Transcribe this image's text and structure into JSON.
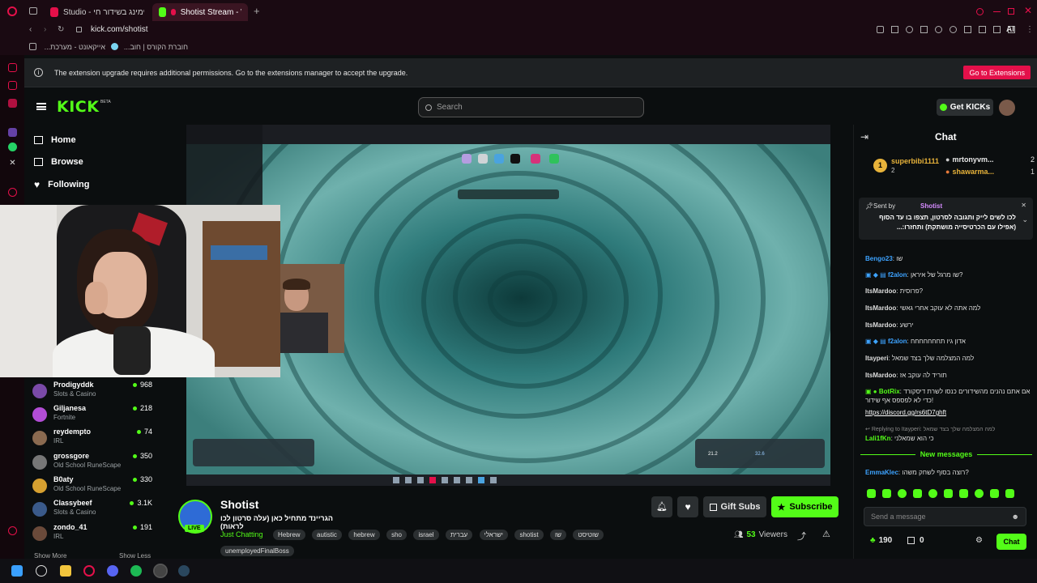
{
  "browser": {
    "tabs": [
      {
        "label": "Studio - סטרימינג בשידור חי",
        "active": false,
        "color": "#e4104a"
      },
      {
        "label": "Shotist Stream - Watch",
        "active": true,
        "color": "#53fc18"
      }
    ],
    "url": "kick.com/shotist",
    "ai_label": "AI",
    "bookmarks": [
      "אייקאונט - מערכת...",
      "חוברת הקורס | חוב..."
    ]
  },
  "extension_bar": {
    "message": "The extension upgrade requires additional permissions. Go to the extensions manager to accept the upgrade.",
    "button": "Go to Extensions"
  },
  "header": {
    "logo": "KICK",
    "beta": "BETA",
    "search_placeholder": "Search",
    "get_kicks": "Get KICKs"
  },
  "nav": {
    "items": [
      {
        "label": "Home",
        "icon": "home-icon"
      },
      {
        "label": "Browse",
        "icon": "browse-icon"
      },
      {
        "label": "Following",
        "icon": "heart-icon"
      }
    ],
    "channels": [
      {
        "name": "Prodigyddk",
        "category": "Slots & Casino",
        "viewers": "968",
        "color": "#7a4aa8"
      },
      {
        "name": "Giljanesa",
        "category": "Fortnite",
        "viewers": "218",
        "color": "#b24dd6"
      },
      {
        "name": "reydempto",
        "category": "IRL",
        "viewers": "74",
        "color": "#8a6a50"
      },
      {
        "name": "grossgore",
        "category": "Old School RuneScape",
        "viewers": "350",
        "color": "#777"
      },
      {
        "name": "B0aty",
        "category": "Old School RuneScape",
        "viewers": "330",
        "color": "#d6a030"
      },
      {
        "name": "Classybeef",
        "category": "Slots & Casino",
        "viewers": "3.1K",
        "color": "#3a5a8a"
      },
      {
        "name": "zondo_41",
        "category": "IRL",
        "viewers": "191",
        "color": "#6a4a3a"
      }
    ],
    "show_more": "Show More",
    "show_less": "Show Less"
  },
  "stream": {
    "streamer": "Shotist",
    "live_badge": "LIVE",
    "title": "הגריינד מתחיל כאן (עלה סרטון לכו לראות)",
    "category": "Just Chatting",
    "tags": [
      "Hebrew",
      "autistic",
      "hebrew",
      "sho",
      "israel",
      "עברית",
      "ישראלי",
      "shotist",
      "שו",
      "שוטיסט",
      "unemployedFinalBoss"
    ],
    "viewers": "53",
    "viewers_label": "Viewers",
    "gift_subs": "Gift Subs",
    "subscribe": "Subscribe"
  },
  "chat": {
    "title": "Chat",
    "top": [
      {
        "name": "superbibi1111",
        "count": "2",
        "rank": "1"
      },
      {
        "name": "mrtonyvm...",
        "count": "2"
      },
      {
        "name": "shawarma...",
        "count": "1"
      }
    ],
    "pinned": {
      "sent_by_label": "Sent by",
      "sender": "Shotist",
      "text": "לכו לשים לייק ותגובה לסרטון, תצפו בו עד הסוף (אפילו עם הכרטיסייה מושתקת) ותחזרו:..."
    },
    "messages": [
      {
        "user": "Bengo23",
        "text": "שו",
        "color": "#3da3ff"
      },
      {
        "user": "f2alon",
        "text": "שו מרגל של איראן?",
        "color": "#3da3ff"
      },
      {
        "user": "ItsMardoo",
        "text": "פרוסית?",
        "color": "#e9e9e9"
      },
      {
        "user": "ItsMardoo",
        "text": "למה אתה לא עוקב אחרי גאשי",
        "color": "#e9e9e9"
      },
      {
        "user": "ItsMardoo",
        "text": "ירשע",
        "color": "#e9e9e9"
      },
      {
        "user": "f2alon",
        "text": "אדון גיו תחחחחחחח",
        "color": "#3da3ff"
      },
      {
        "user": "Itayperi",
        "text": "למה המצלמה שלך בצד שמאל",
        "color": "#e9e9e9"
      },
      {
        "user": "ItsMardoo",
        "text": "תוריד לה עוקב אז",
        "color": "#e9e9e9"
      },
      {
        "user": "BotRix",
        "text": "אם אתם נהנים מהשידורים כנסו לשרת דיסקורד כדי לא לפספס אף שידור!",
        "color": "#53fc18"
      }
    ],
    "botrix_link": "https://discord.gg/rs6tD7ghft",
    "reply_label": "Replying to Itayperi:",
    "reply_quote": "למה המצלמה שלך בצד שמאל",
    "reply_msg": {
      "user": "Lali1fKn",
      "text": "כי הוא שמאלני",
      "color": "#53fc18"
    },
    "new_messages": "New messages",
    "last_msg": {
      "user": "EmmaKlec",
      "text": "רוצה בסוף לשחק משהו?",
      "color": "#3da3ff"
    },
    "input_placeholder": "Send a message",
    "points": "190",
    "gifts": "0",
    "send": "Chat"
  },
  "video_screen": {
    "top_labels": [
      "Instagram",
      "YouTube",
      "YouTube"
    ],
    "readout_1": "21.2",
    "readout_2": "32.6"
  }
}
